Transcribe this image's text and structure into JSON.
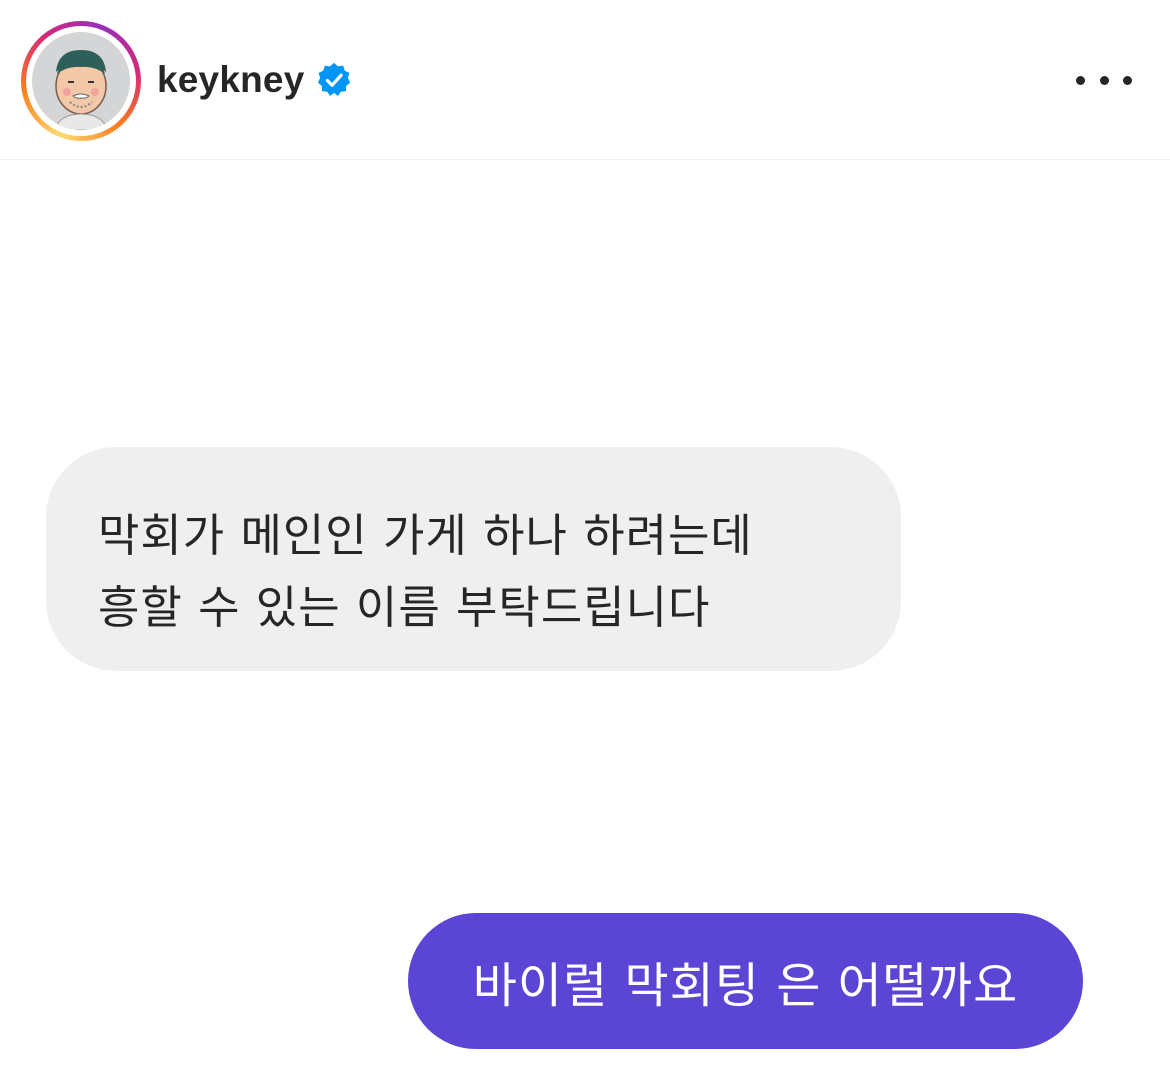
{
  "header": {
    "username": "keykney",
    "verified_icon": "verified-badge-icon",
    "more_icon": "more-horizontal-icon",
    "avatar_icon": "profile-avatar-illustration"
  },
  "conversation": {
    "incoming": {
      "lines": [
        "막회가 메인인 가게 하나 하려는데",
        "흥할 수 있는 이름 부탁드립니다"
      ]
    },
    "outgoing": {
      "text": "바이럴 막회팅 은 어떨까요"
    }
  },
  "colors": {
    "incoming_bubble": "#efefef",
    "outgoing_bubble": "#5a45d4",
    "verified_blue": "#0095f6",
    "text_dark": "#262626"
  }
}
